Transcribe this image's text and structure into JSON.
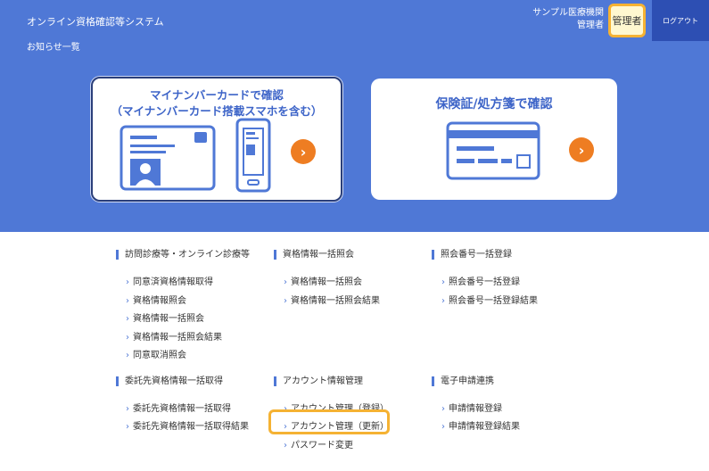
{
  "header": {
    "app_title": "オンライン資格確認等システム",
    "news_link": "お知らせ一覧",
    "org_name": "サンプル医療機関",
    "user_name": "管理者",
    "role_badge": "管理者",
    "logout_label": "ログアウト"
  },
  "cards": {
    "mynumber": {
      "title_line1": "マイナンバーカードで確認",
      "title_line2": "（マイナンバーカード搭載スマホを含む）"
    },
    "insurance": {
      "title": "保険証/処方箋で確認"
    }
  },
  "sections": [
    {
      "heading": "訪問診療等・オンライン診療等",
      "links": [
        "同意済資格情報取得",
        "資格情報照会",
        "資格情報一括照会",
        "資格情報一括照会結果",
        "同意取消照会"
      ]
    },
    {
      "heading": "資格情報一括照会",
      "links": [
        "資格情報一括照会",
        "資格情報一括照会結果"
      ]
    },
    {
      "heading": "照会番号一括登録",
      "links": [
        "照会番号一括登録",
        "照会番号一括登録結果"
      ]
    },
    {
      "heading": "委託先資格情報一括取得",
      "links": [
        "委託先資格情報一括取得",
        "委託先資格情報一括取得結果"
      ]
    },
    {
      "heading": "アカウント情報管理",
      "links": [
        "アカウント管理（登録）",
        "アカウント管理（更新）",
        "パスワード変更"
      ]
    },
    {
      "heading": "電子申請連携",
      "links": [
        "申請情報登録",
        "申請情報登録結果"
      ]
    }
  ],
  "colors": {
    "header_blue": "#4f78d6",
    "logout_blue": "#2d4fb3",
    "accent_orange": "#ee7d22",
    "highlight_yellow": "#f5b233"
  },
  "icons": {
    "chevron": "›",
    "arrow": "›"
  }
}
